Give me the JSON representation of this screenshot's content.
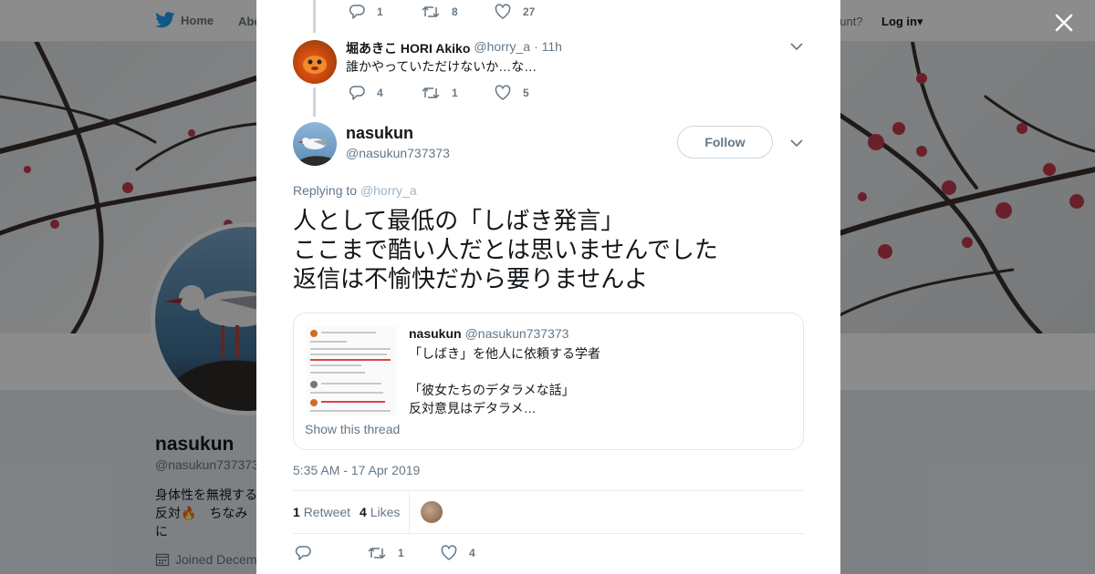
{
  "topnav": {
    "home_label": "Home",
    "about_label": "Abo",
    "account_prompt": "ccount?",
    "login_label": "Log in▾"
  },
  "profile": {
    "name": "nasukun",
    "handle": "@nasukun737373",
    "bio": "身体性を無視する\n反対🔥　ちなみに\nない　判断基準は",
    "joined": "Joined Decem"
  },
  "thread": {
    "prev_actions": {
      "replies": "1",
      "retweets": "8",
      "likes": "27"
    },
    "reply": {
      "name": "堀あきこ HORI Akiko",
      "handle": "@horry_a",
      "time": "· 11h",
      "text": "誰かやっていただけないか…な…",
      "actions": {
        "replies": "4",
        "retweets": "1",
        "likes": "5"
      }
    }
  },
  "main_tweet": {
    "name": "nasukun",
    "handle": "@nasukun737373",
    "follow_label": "Follow",
    "replying_prefix": "Replying to ",
    "replying_to": "@horry_a",
    "text_lines": [
      "人として最低の「しばき発言」",
      "ここまで酷い人だとは思いませんでした",
      "返信は不愉快だから要りませんよ"
    ],
    "quote": {
      "name": "nasukun",
      "handle": "@nasukun737373",
      "lines": [
        "「しばき」を他人に依頼する学者",
        "",
        "「彼女たちのデタラメな話」",
        "反対意見はデタラメ…"
      ],
      "show_thread": "Show this thread"
    },
    "timestamp": "5:35 AM - 17 Apr 2019",
    "stats": {
      "retweets_count": "1",
      "retweets_label": "Retweet",
      "likes_count": "4",
      "likes_label": "Likes"
    },
    "actions": {
      "replies": "",
      "retweets": "1",
      "likes": "4"
    }
  },
  "colors": {
    "text": "#14171a",
    "muted": "#657786",
    "border": "#e6ecf0",
    "twitter_blue": "#1da1f2"
  }
}
